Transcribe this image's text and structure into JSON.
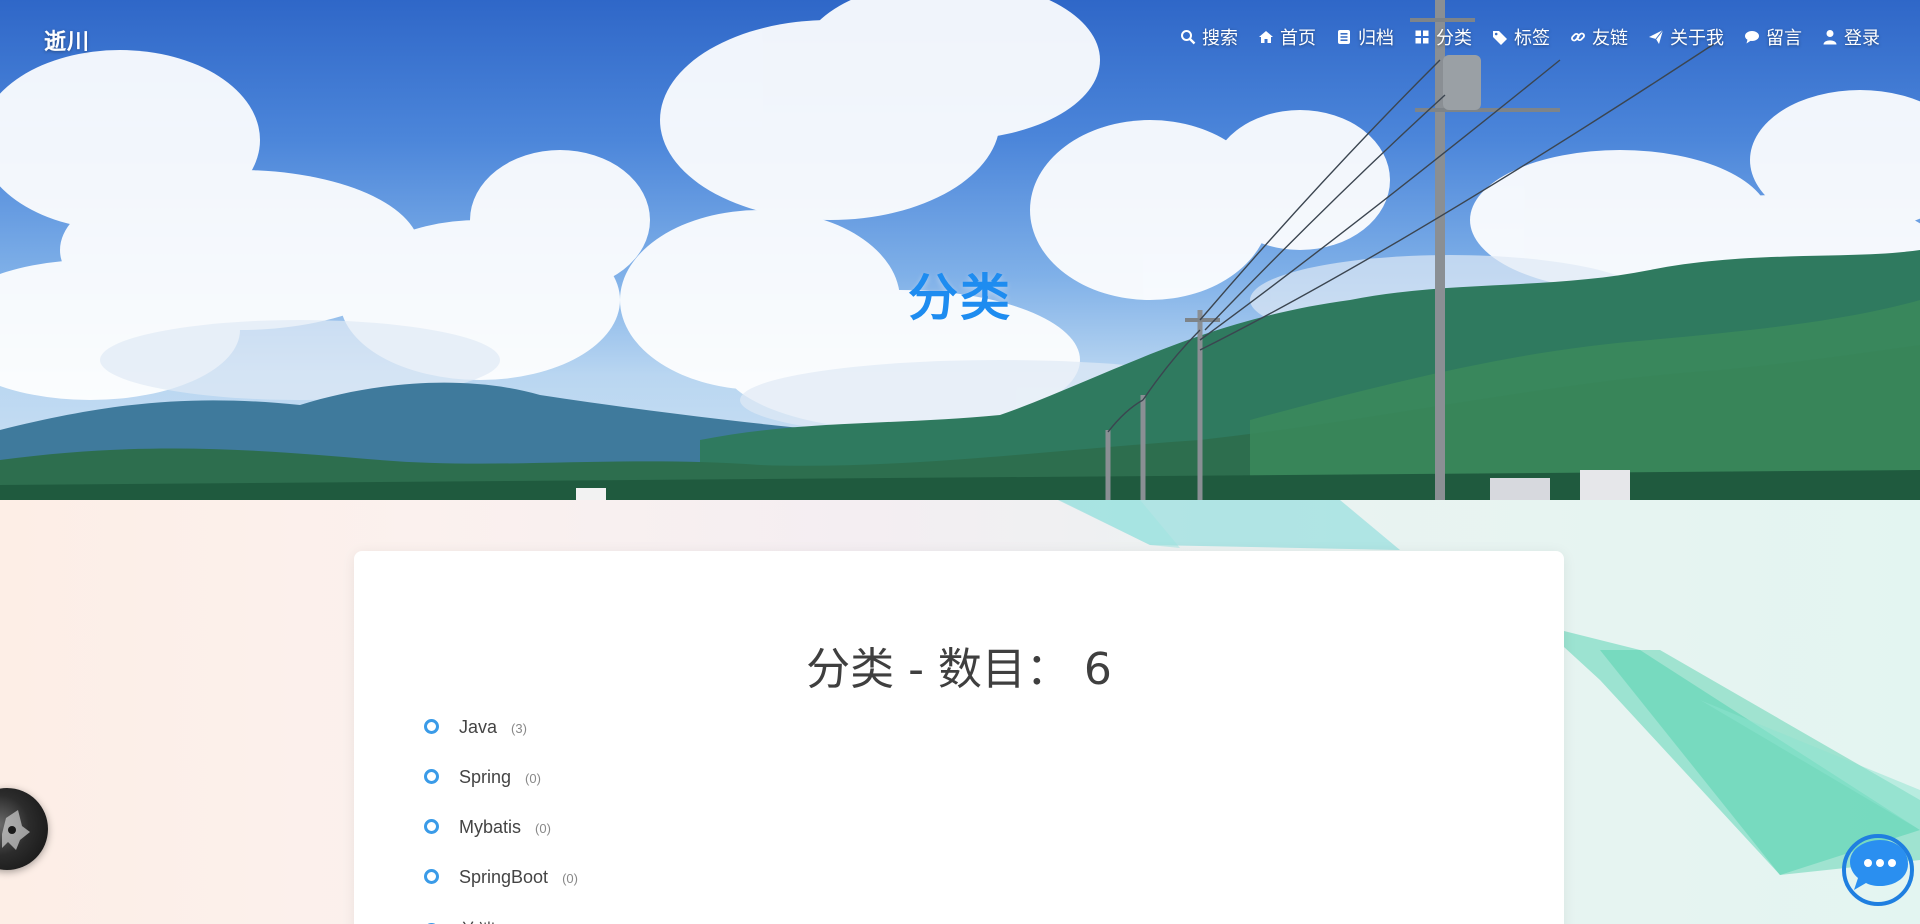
{
  "header": {
    "brand": "逝川",
    "nav": [
      {
        "label": "搜索",
        "icon": "search-icon"
      },
      {
        "label": "首页",
        "icon": "home-icon"
      },
      {
        "label": "归档",
        "icon": "archive-icon"
      },
      {
        "label": "分类",
        "icon": "grid-icon"
      },
      {
        "label": "标签",
        "icon": "tag-icon"
      },
      {
        "label": "友链",
        "icon": "link-icon"
      },
      {
        "label": "关于我",
        "icon": "paper-plane-icon"
      },
      {
        "label": "留言",
        "icon": "comment-icon"
      },
      {
        "label": "登录",
        "icon": "user-icon"
      }
    ]
  },
  "hero": {
    "title": "分类"
  },
  "main": {
    "title": "分类 - 数目： 6",
    "categories": [
      {
        "name": "Java",
        "count": "(3)"
      },
      {
        "name": "Spring",
        "count": "(0)"
      },
      {
        "name": "Mybatis",
        "count": "(0)"
      },
      {
        "name": "SpringBoot",
        "count": "(0)"
      },
      {
        "name": "前端",
        "count": ""
      }
    ]
  },
  "floating": {
    "avatar_icon": "avatar",
    "chat_icon": "chat-bubble-icon"
  },
  "colors": {
    "hero_title": "#1e8cf0",
    "bullet": "#3a9be8",
    "chat": "#2a8ff0"
  }
}
